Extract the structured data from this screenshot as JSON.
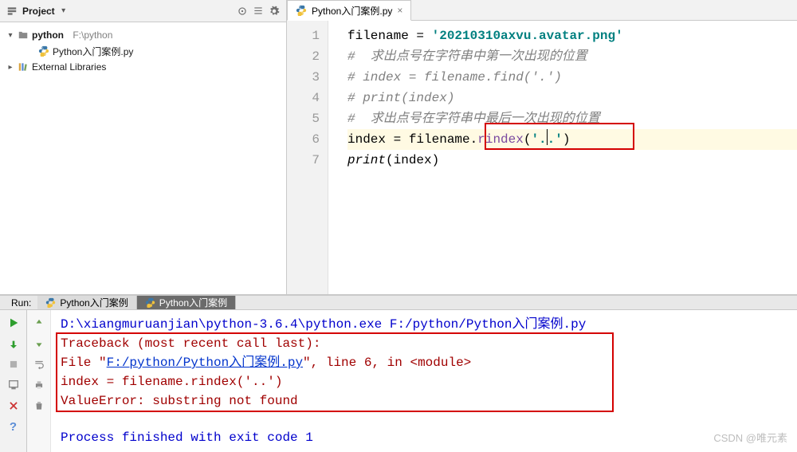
{
  "project": {
    "pane_title": "Project",
    "root_name": "python",
    "root_path": "F:\\python",
    "file_item": "Python入门案例.py",
    "external_libs": "External Libraries"
  },
  "editor": {
    "tab_label": "Python入门案例.py",
    "close_glyph": "×",
    "gutter": {
      "l1": "1",
      "l2": "2",
      "l3": "3",
      "l4": "4",
      "l5": "5",
      "l6": "6",
      "l7": "7"
    },
    "line1": {
      "lhs": "filename ",
      "eq": "= ",
      "str": "'20210310axvu.avatar.png'"
    },
    "line2": "#  求出点号在字符串中第一次出现的位置",
    "line3": "# index = filename.find('.')",
    "line4": "# print(index)",
    "line5": "#  求出点号在字符串中最后一次出现的位置",
    "line6": {
      "a": "index ",
      "eq": "= ",
      "b": "filename",
      "dot": ".",
      "fn": "rindex",
      "lp": "(",
      "s1": "'.",
      "s2": ".'",
      "rp": ")"
    },
    "line7": {
      "fn": "print",
      "lp": "(",
      "arg": "index",
      "rp": ")"
    }
  },
  "run": {
    "label": "Run:",
    "tab1": "Python入门案例",
    "tab2": "Python入门案例",
    "cmd": "D:\\xiangmuruanjian\\python-3.6.4\\python.exe F:/python/Python入门案例.py",
    "tb1": "Traceback (most recent call last):",
    "tb2a": "  File \"",
    "tb2link": "F:/python/Python入门案例.py",
    "tb2b": "\", line 6, in <module>",
    "tb3": "    index = filename.rindex('..')",
    "tb4": "ValueError: substring not found",
    "exit": "Process finished with exit code 1"
  },
  "watermark": "CSDN @唯元素"
}
